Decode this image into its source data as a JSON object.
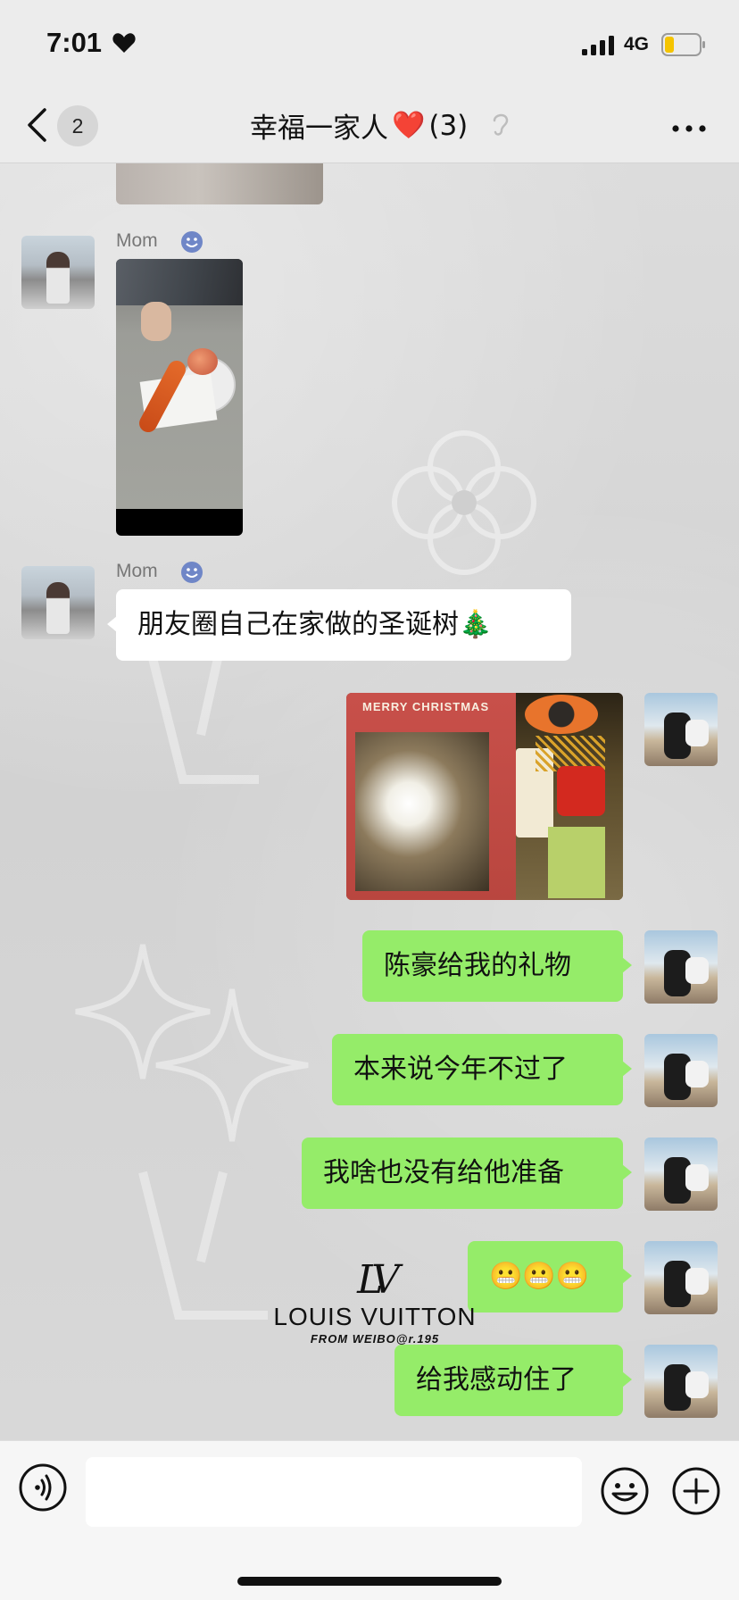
{
  "status_bar": {
    "time": "7:01",
    "network": "4G"
  },
  "nav": {
    "back_badge": "2",
    "title": "幸福一家人",
    "title_emoji": "❤️",
    "member_count": "(3)"
  },
  "messages": [
    {
      "id": "m1",
      "sender": "Mom",
      "direction": "in",
      "type": "image"
    },
    {
      "id": "m2",
      "sender": "Mom",
      "direction": "in",
      "type": "text",
      "text": "朋友圈自己在家做的圣诞树🎄"
    },
    {
      "id": "m3",
      "sender": "me",
      "direction": "out",
      "type": "image",
      "image_text": "MERRY CHRISTMAS"
    },
    {
      "id": "m4",
      "sender": "me",
      "direction": "out",
      "type": "text",
      "text": "陈豪给我的礼物"
    },
    {
      "id": "m5",
      "sender": "me",
      "direction": "out",
      "type": "text",
      "text": "本来说今年不过了"
    },
    {
      "id": "m6",
      "sender": "me",
      "direction": "out",
      "type": "text",
      "text": "我啥也没有给他准备"
    },
    {
      "id": "m7",
      "sender": "me",
      "direction": "out",
      "type": "text",
      "text": "😬😬😬"
    },
    {
      "id": "m8",
      "sender": "me",
      "direction": "out",
      "type": "text",
      "text": "给我感动住了"
    }
  ],
  "watermark": {
    "brand": "LOUIS VUITTON",
    "monogram": "LV",
    "source": "FROM WEIBO@r.195"
  },
  "input_bar": {
    "value": "",
    "icons": [
      "voice-icon",
      "emoji-icon",
      "plus-icon"
    ]
  },
  "colors": {
    "outgoing_bubble": "#95ec69",
    "incoming_bubble": "#ffffff",
    "bar_background": "#ececec"
  }
}
